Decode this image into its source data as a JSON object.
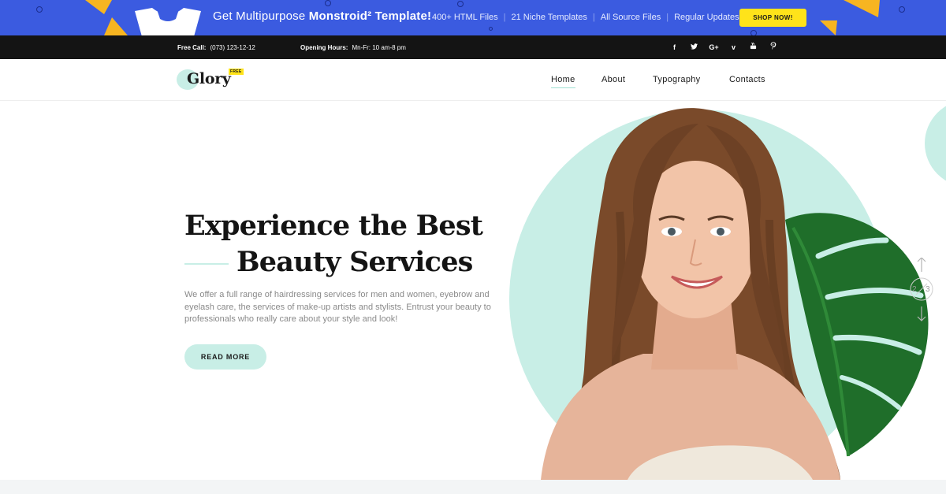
{
  "promo": {
    "headline_prefix": "Get Multipurpose",
    "headline_brand": "Monstroid² Template!",
    "features": [
      "400+ HTML Files",
      "21 Niche Templates",
      "All Source Files",
      "Regular Updates"
    ],
    "shop_label": "SHOP NOW!",
    "colors": {
      "background": "#3b5be0",
      "button": "#ffe31a",
      "accent": "#f7b521"
    }
  },
  "infobar": {
    "call_label": "Free Call:",
    "call_value": "(073) 123-12-12",
    "hours_label": "Opening Hours:",
    "hours_value": "Mn-Fr: 10 am-8 pm",
    "social": [
      {
        "icon": "facebook-icon",
        "glyph": "f"
      },
      {
        "icon": "twitter-icon",
        "glyph": "🐦"
      },
      {
        "icon": "google-plus-icon",
        "glyph": "G+"
      },
      {
        "icon": "vimeo-icon",
        "glyph": "v"
      },
      {
        "icon": "youtube-icon",
        "glyph": "▣"
      },
      {
        "icon": "pinterest-icon",
        "glyph": "P"
      }
    ]
  },
  "header": {
    "logo_text": "Glory",
    "logo_badge": "FREE",
    "nav": [
      "Home",
      "About",
      "Typography",
      "Contacts"
    ],
    "active_nav": "Home"
  },
  "hero": {
    "title_line1": "Experience the Best",
    "title_line2": "Beauty Services",
    "description": "We offer a full range of hairdressing services for men and women, eyebrow and eyelash care, the services of make-up artists and stylists. Entrust your beauty to professionals who really care about your style and look!",
    "button_label": "READ MORE",
    "slide_current": "2",
    "slide_total": "3",
    "colors": {
      "mint": "#c8eee6",
      "title": "#141414",
      "text": "#8a8a8a"
    }
  }
}
